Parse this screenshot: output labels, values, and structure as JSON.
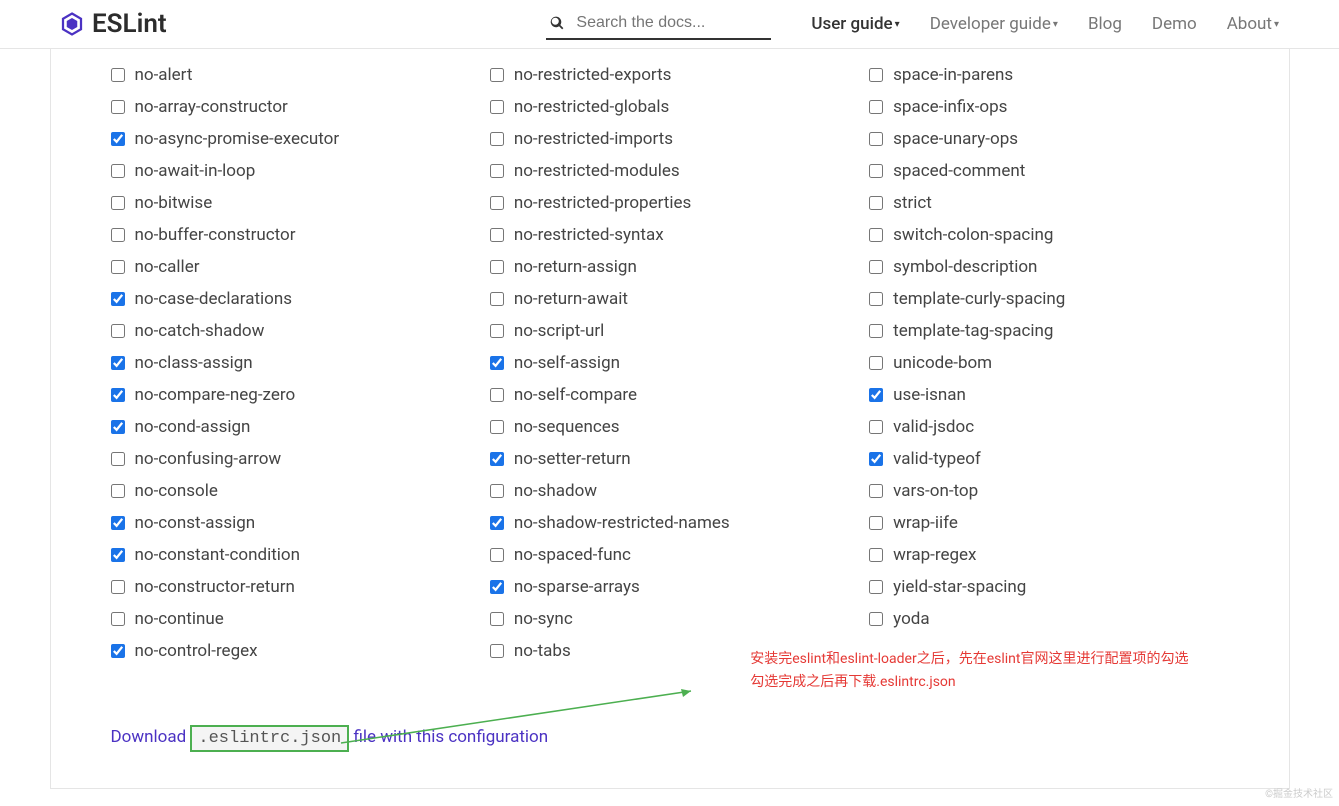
{
  "header": {
    "logo_text": "ESLint",
    "search_placeholder": "Search the docs...",
    "nav": [
      {
        "label": "User guide",
        "dropdown": true,
        "active": true
      },
      {
        "label": "Developer guide",
        "dropdown": true,
        "active": false
      },
      {
        "label": "Blog",
        "dropdown": false,
        "active": false
      },
      {
        "label": "Demo",
        "dropdown": false,
        "active": false
      },
      {
        "label": "About",
        "dropdown": true,
        "active": false
      }
    ]
  },
  "rules": {
    "col1": [
      {
        "label": "no-alert",
        "checked": false
      },
      {
        "label": "no-array-constructor",
        "checked": false
      },
      {
        "label": "no-async-promise-executor",
        "checked": true
      },
      {
        "label": "no-await-in-loop",
        "checked": false
      },
      {
        "label": "no-bitwise",
        "checked": false
      },
      {
        "label": "no-buffer-constructor",
        "checked": false
      },
      {
        "label": "no-caller",
        "checked": false
      },
      {
        "label": "no-case-declarations",
        "checked": true
      },
      {
        "label": "no-catch-shadow",
        "checked": false
      },
      {
        "label": "no-class-assign",
        "checked": true
      },
      {
        "label": "no-compare-neg-zero",
        "checked": true
      },
      {
        "label": "no-cond-assign",
        "checked": true
      },
      {
        "label": "no-confusing-arrow",
        "checked": false
      },
      {
        "label": "no-console",
        "checked": false
      },
      {
        "label": "no-const-assign",
        "checked": true
      },
      {
        "label": "no-constant-condition",
        "checked": true
      },
      {
        "label": "no-constructor-return",
        "checked": false
      },
      {
        "label": "no-continue",
        "checked": false
      },
      {
        "label": "no-control-regex",
        "checked": true
      }
    ],
    "col2": [
      {
        "label": "no-restricted-exports",
        "checked": false
      },
      {
        "label": "no-restricted-globals",
        "checked": false
      },
      {
        "label": "no-restricted-imports",
        "checked": false
      },
      {
        "label": "no-restricted-modules",
        "checked": false
      },
      {
        "label": "no-restricted-properties",
        "checked": false
      },
      {
        "label": "no-restricted-syntax",
        "checked": false
      },
      {
        "label": "no-return-assign",
        "checked": false
      },
      {
        "label": "no-return-await",
        "checked": false
      },
      {
        "label": "no-script-url",
        "checked": false
      },
      {
        "label": "no-self-assign",
        "checked": true
      },
      {
        "label": "no-self-compare",
        "checked": false
      },
      {
        "label": "no-sequences",
        "checked": false
      },
      {
        "label": "no-setter-return",
        "checked": true
      },
      {
        "label": "no-shadow",
        "checked": false
      },
      {
        "label": "no-shadow-restricted-names",
        "checked": true
      },
      {
        "label": "no-spaced-func",
        "checked": false
      },
      {
        "label": "no-sparse-arrays",
        "checked": true
      },
      {
        "label": "no-sync",
        "checked": false
      },
      {
        "label": "no-tabs",
        "checked": false
      }
    ],
    "col3": [
      {
        "label": "space-in-parens",
        "checked": false
      },
      {
        "label": "space-infix-ops",
        "checked": false
      },
      {
        "label": "space-unary-ops",
        "checked": false
      },
      {
        "label": "spaced-comment",
        "checked": false
      },
      {
        "label": "strict",
        "checked": false
      },
      {
        "label": "switch-colon-spacing",
        "checked": false
      },
      {
        "label": "symbol-description",
        "checked": false
      },
      {
        "label": "template-curly-spacing",
        "checked": false
      },
      {
        "label": "template-tag-spacing",
        "checked": false
      },
      {
        "label": "unicode-bom",
        "checked": false
      },
      {
        "label": "use-isnan",
        "checked": true
      },
      {
        "label": "valid-jsdoc",
        "checked": false
      },
      {
        "label": "valid-typeof",
        "checked": true
      },
      {
        "label": "vars-on-top",
        "checked": false
      },
      {
        "label": "wrap-iife",
        "checked": false
      },
      {
        "label": "wrap-regex",
        "checked": false
      },
      {
        "label": "yield-star-spacing",
        "checked": false
      },
      {
        "label": "yoda",
        "checked": false
      }
    ]
  },
  "download": {
    "prefix": "Download ",
    "filename": ".eslintrc.json",
    "suffix": " file with this configuration"
  },
  "annotation": {
    "line1": "安装完eslint和eslint-loader之后，先在eslint官网这里进行配置项的勾选",
    "line2": "勾选完成之后再下载.eslintrc.json"
  },
  "watermark": "©掘金技术社区"
}
